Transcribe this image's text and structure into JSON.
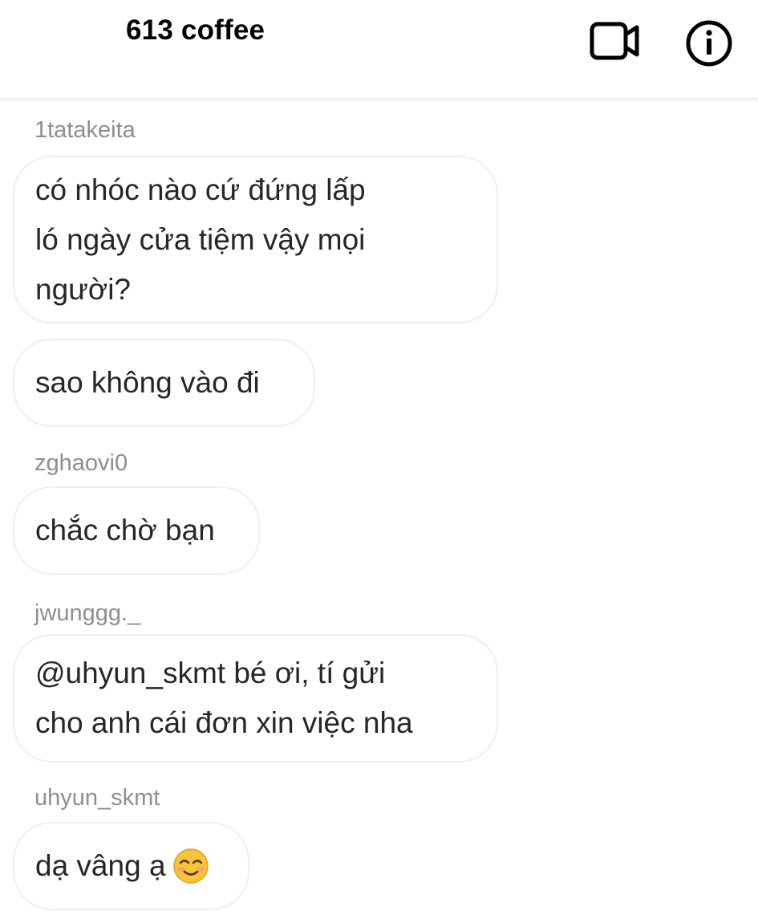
{
  "header": {
    "title": "613 coffee",
    "video_icon": "video-camera-icon",
    "info_icon": "info-circle-icon"
  },
  "messages": [
    {
      "sender": "1tatakeita",
      "text": "có nhóc nào cứ đứng lấp\nló ngày cửa tiệm vậy mọi\nngười?"
    },
    {
      "sender": "",
      "text": "sao không vào đi"
    },
    {
      "sender": "zghaovi0",
      "text": "chắc chờ bạn"
    },
    {
      "sender": "jwunggg._",
      "text": "@uhyun_skmt bé ơi, tí gửi\ncho anh cái đơn xin việc nha"
    },
    {
      "sender": "uhyun_skmt",
      "text": "dạ vâng ạ",
      "emoji": "smiling-face-icon"
    }
  ],
  "colors": {
    "bubble_border": "#efefef",
    "sender_text": "#8e8e8e",
    "message_text": "#262626",
    "emoji_yellow": "#f7c33a"
  }
}
